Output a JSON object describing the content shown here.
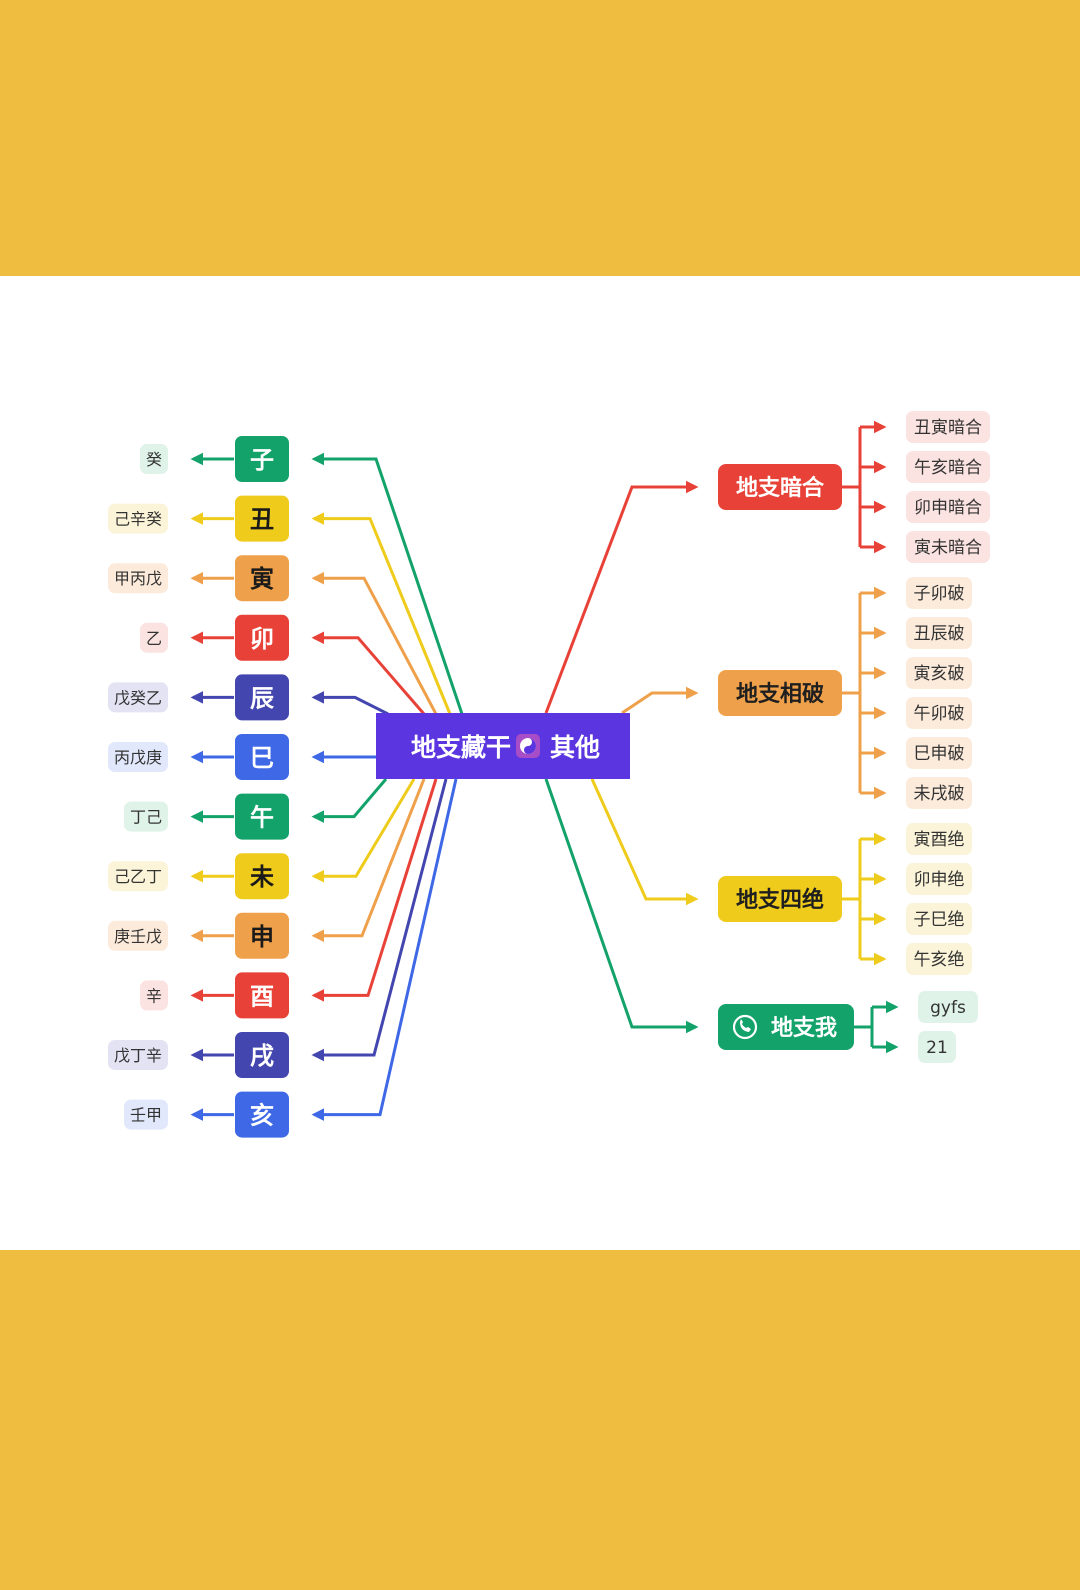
{
  "center": {
    "title": "地支藏干",
    "suffix": "其他",
    "color": "#5B35E0"
  },
  "branches": [
    {
      "name": "子",
      "hidden": "癸",
      "color": "#13A26A",
      "pale": "#DFF3E9"
    },
    {
      "name": "丑",
      "hidden": "己辛癸",
      "color": "#EFCB1C",
      "pale": "#FBF4D8"
    },
    {
      "name": "寅",
      "hidden": "甲丙戊",
      "color": "#EFA04A",
      "pale": "#FCEBDA"
    },
    {
      "name": "卯",
      "hidden": "乙",
      "color": "#E84238",
      "pale": "#FBE3E1"
    },
    {
      "name": "辰",
      "hidden": "戊癸乙",
      "color": "#4446B0",
      "pale": "#E3E3F4"
    },
    {
      "name": "巳",
      "hidden": "丙戊庚",
      "color": "#3E68E6",
      "pale": "#E1E8FB"
    },
    {
      "name": "午",
      "hidden": "丁己",
      "color": "#13A26A",
      "pale": "#DFF3E9"
    },
    {
      "name": "未",
      "hidden": "己乙丁",
      "color": "#EFCB1C",
      "pale": "#FBF4D8"
    },
    {
      "name": "申",
      "hidden": "庚壬戊",
      "color": "#EFA04A",
      "pale": "#FCEBDA"
    },
    {
      "name": "酉",
      "hidden": "辛",
      "color": "#E84238",
      "pale": "#FBE3E1"
    },
    {
      "name": "戌",
      "hidden": "戊丁辛",
      "color": "#4446B0",
      "pale": "#E3E3F4"
    },
    {
      "name": "亥",
      "hidden": "壬甲",
      "color": "#3E68E6",
      "pale": "#E1E8FB"
    }
  ],
  "groups": [
    {
      "title": "地支暗合",
      "color": "#E84238",
      "pale": "#FBE3E1",
      "text": "#ffffff",
      "items": [
        "丑寅暗合",
        "午亥暗合",
        "卯申暗合",
        "寅未暗合"
      ]
    },
    {
      "title": "地支相破",
      "color": "#EFA04A",
      "pale": "#FCEBDA",
      "text": "#1f1f1f",
      "items": [
        "子卯破",
        "丑辰破",
        "寅亥破",
        "午卯破",
        "巳申破",
        "未戌破"
      ]
    },
    {
      "title": "地支四绝",
      "color": "#EFCB1C",
      "pale": "#FBF4D8",
      "text": "#1f1f1f",
      "items": [
        "寅酉绝",
        "卯申绝",
        "子巳绝",
        "午亥绝"
      ]
    },
    {
      "title": "地支我",
      "color": "#13A26A",
      "pale": "#DFF3E9",
      "text": "#ffffff",
      "icon": "phone-icon",
      "items": [
        "gyfs",
        "21"
      ]
    }
  ]
}
